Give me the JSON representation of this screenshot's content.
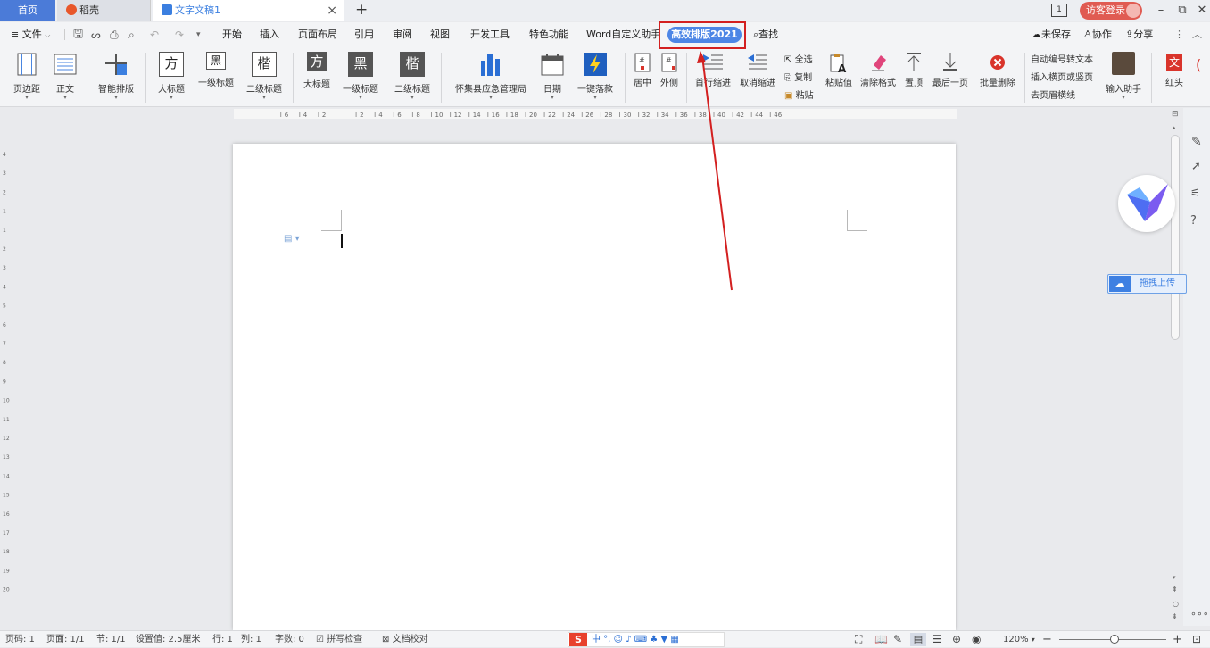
{
  "tabs": {
    "home": "首页",
    "daoke": "稻壳",
    "doc": "文字文稿1",
    "close": "×",
    "add": "+"
  },
  "titlebar": {
    "page_indicator": "1",
    "guest_login": "访客登录",
    "minimize": "–",
    "restore": "⧉",
    "close": "✕"
  },
  "menu": {
    "file": "≡ 文件",
    "items": [
      "开始",
      "插入",
      "页面布局",
      "引用",
      "审阅",
      "视图",
      "开发工具",
      "特色功能",
      "Word自定义助手"
    ],
    "highlight": "高效排版2021",
    "search": "查找",
    "unsaved": "未保存",
    "collab": "协作",
    "share": "分享"
  },
  "ribbon": {
    "margin": "页边距",
    "body_text": "正文",
    "smart_layout": "智能排版",
    "big_title": "大标题",
    "level1": "一级标题",
    "level2": "二级标题",
    "big_title2": "大标题",
    "level1_b": "一级标题",
    "level2_b": "二级标题",
    "bureau": "怀集县应急管理局",
    "date": "日期",
    "one_key_sign": "一键落款",
    "center": "居中",
    "outside": "外侧",
    "first_indent": "首行缩进",
    "cancel_indent": "取消缩进",
    "select_all": "全选",
    "copy": "复制",
    "paste": "粘贴",
    "paste_value": "粘贴值",
    "clear_format": "清除格式",
    "top": "置顶",
    "last_page": "最后一页",
    "batch_delete": "批量删除",
    "auto_number": "自动编号转文本",
    "insert_page": "插入横页或竖页",
    "remove_header_line": "去页眉横线",
    "input_helper": "输入助手",
    "red_head": "红头",
    "char_fang": "方",
    "char_hei": "黑",
    "char_kai": "楷",
    "char_wen": "文"
  },
  "ruler": {
    "marks": [
      "6",
      "4",
      "2",
      "2",
      "4",
      "6",
      "8",
      "10",
      "12",
      "14",
      "16",
      "18",
      "20",
      "22",
      "24",
      "26",
      "28",
      "30",
      "32",
      "34",
      "36",
      "38",
      "40",
      "42",
      "44",
      "46"
    ],
    "left_marks": [
      "4",
      "3",
      "2",
      "1",
      "1",
      "2",
      "3",
      "4",
      "5",
      "6",
      "7",
      "8",
      "9",
      "10",
      "11",
      "12",
      "13",
      "14",
      "15",
      "16",
      "17",
      "18",
      "19",
      "20"
    ]
  },
  "sidepanel": {
    "upload": "拖拽上传"
  },
  "status": {
    "page_num": "页码: 1",
    "pages": "页面: 1/1",
    "section": "节: 1/1",
    "setting": "设置值: 2.5厘米",
    "row": "行: 1",
    "col": "列: 1",
    "word_count": "字数: 0",
    "spell_check": "拼写检查",
    "doc_proof": "文档校对",
    "ime": "中 °, ☺ ♪ ⌨ ♣ ▼ ▦",
    "zoom": "120%"
  },
  "colors": {
    "accent": "#4d86e6",
    "annotation_red": "#d32020",
    "guest_red": "#e05b52"
  }
}
